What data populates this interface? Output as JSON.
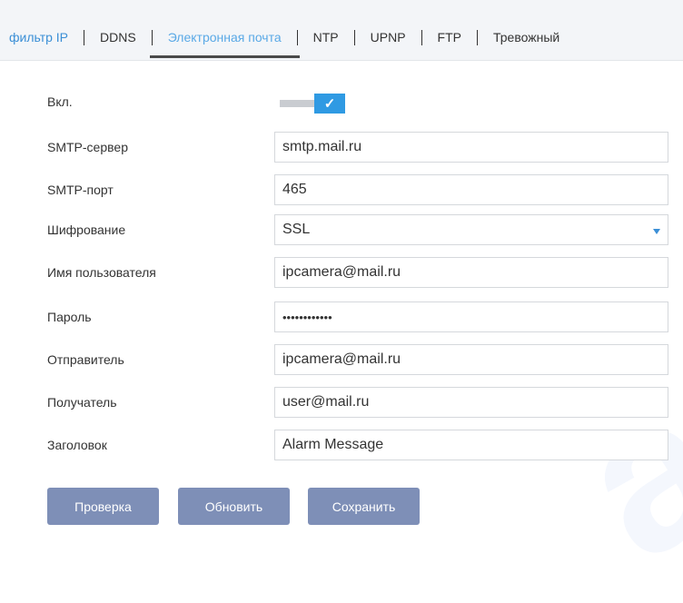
{
  "tabs": [
    {
      "label": "фильтр IP"
    },
    {
      "label": "DDNS"
    },
    {
      "label": "Электронная почта"
    },
    {
      "label": "NTP"
    },
    {
      "label": "UPNP"
    },
    {
      "label": "FTP"
    },
    {
      "label": "Тревожный"
    }
  ],
  "form": {
    "enable_label": "Вкл.",
    "enabled": true,
    "smtp_server_label": "SMTP-сервер",
    "smtp_server_value": "smtp.mail.ru",
    "smtp_port_label": "SMTP-порт",
    "smtp_port_value": "465",
    "encryption_label": "Шифрование",
    "encryption_value": "SSL",
    "username_label": "Имя пользователя",
    "username_value": "ipcamera@mail.ru",
    "password_label": "Пароль",
    "password_value": "••••••••••••",
    "sender_label": "Отправитель",
    "sender_value": "ipcamera@mail.ru",
    "recipient_label": "Получатель",
    "recipient_value": "user@mail.ru",
    "subject_label": "Заголовок",
    "subject_value": "Alarm Message"
  },
  "buttons": {
    "test": "Проверка",
    "refresh": "Обновить",
    "save": "Сохранить"
  },
  "icons": {
    "toggle_check": "check-icon",
    "select_arrow": "caret-down-icon"
  },
  "colors": {
    "accent": "#2f9ae3",
    "active_tab_text": "#5aa9e6",
    "button_bg": "#7e8fb7"
  }
}
